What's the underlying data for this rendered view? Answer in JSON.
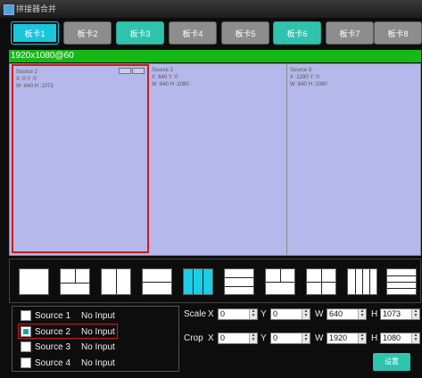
{
  "window": {
    "title": "拼接器合并"
  },
  "tabs": [
    {
      "label": "板卡1",
      "style": "active"
    },
    {
      "label": "板卡2",
      "style": "gray"
    },
    {
      "label": "板卡3",
      "style": "teal"
    },
    {
      "label": "板卡4",
      "style": "gray"
    },
    {
      "label": "板卡5",
      "style": "gray"
    },
    {
      "label": "板卡6",
      "style": "teal"
    },
    {
      "label": "板卡7",
      "style": "gray"
    },
    {
      "label": "板卡8",
      "style": "gray"
    }
  ],
  "resolution": "1920x1080@60",
  "preview_windows": [
    {
      "source": "Source 2",
      "pos": "X :0 Y :0",
      "size": "W :640 H :1073"
    },
    {
      "source": "Source 2",
      "pos": "X :640 Y :0",
      "size": "W :640 H :1080"
    },
    {
      "source": "Source 3",
      "pos": "X :1280 Y :0",
      "size": "W :640 H :1080"
    }
  ],
  "sources": [
    {
      "name": "Source 1",
      "status": "No Input",
      "checked": false
    },
    {
      "name": "Source 2",
      "status": "No Input",
      "checked": true
    },
    {
      "name": "Source 3",
      "status": "No Input",
      "checked": false
    },
    {
      "name": "Source 4",
      "status": "No Input",
      "checked": false
    }
  ],
  "scale": {
    "label": "Scale",
    "x_label": "X",
    "y_label": "Y",
    "w_label": "W",
    "h_label": "H",
    "x": "0",
    "y": "0",
    "w": "640",
    "h": "1073"
  },
  "crop": {
    "label": "Crop",
    "x_label": "X",
    "y_label": "Y",
    "w_label": "W",
    "h_label": "H",
    "x": "0",
    "y": "0",
    "w": "1920",
    "h": "1080"
  },
  "set_button": "设置",
  "colors": {
    "accent": "#19c6dc",
    "teal": "#2fc3ae",
    "resbar": "#16b816",
    "preview_bg": "#b5b8ea",
    "selection": "#d11b1b"
  }
}
